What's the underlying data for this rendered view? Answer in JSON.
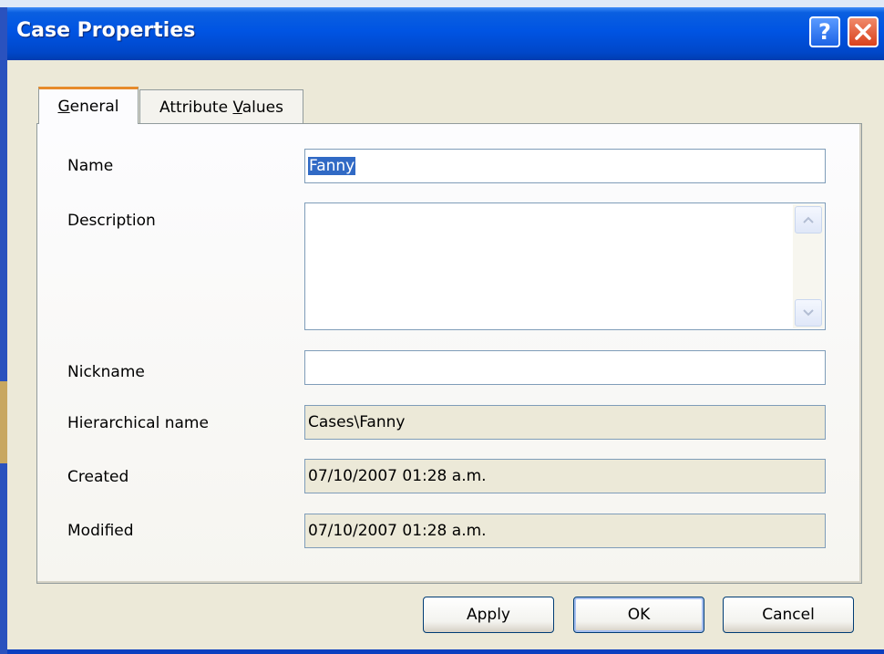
{
  "window": {
    "title": "Case Properties"
  },
  "titlebar": {
    "help_glyph": "?",
    "close_icon": "close-icon"
  },
  "tabs": [
    {
      "label_pre": "",
      "label_u": "G",
      "label_post": "eneral",
      "active": true
    },
    {
      "label_pre": "Attribute ",
      "label_u": "V",
      "label_post": "alues",
      "active": false
    }
  ],
  "fields": {
    "name": {
      "label": "Name",
      "value": "Fanny"
    },
    "description": {
      "label": "Description",
      "value": ""
    },
    "nickname": {
      "label": "Nickname",
      "value": ""
    },
    "hierarchical": {
      "label": "Hierarchical name",
      "value": "Cases\\Fanny"
    },
    "created": {
      "label": "Created",
      "value": "07/10/2007 01:28 a.m."
    },
    "modified": {
      "label": "Modified",
      "value": "07/10/2007 01:28 a.m."
    }
  },
  "buttons": {
    "apply": "Apply",
    "ok": "OK",
    "cancel": "Cancel"
  },
  "colors": {
    "titlebar": "#0054e3",
    "active_tab_accent": "#e68b2c",
    "selection": "#316ac5"
  }
}
